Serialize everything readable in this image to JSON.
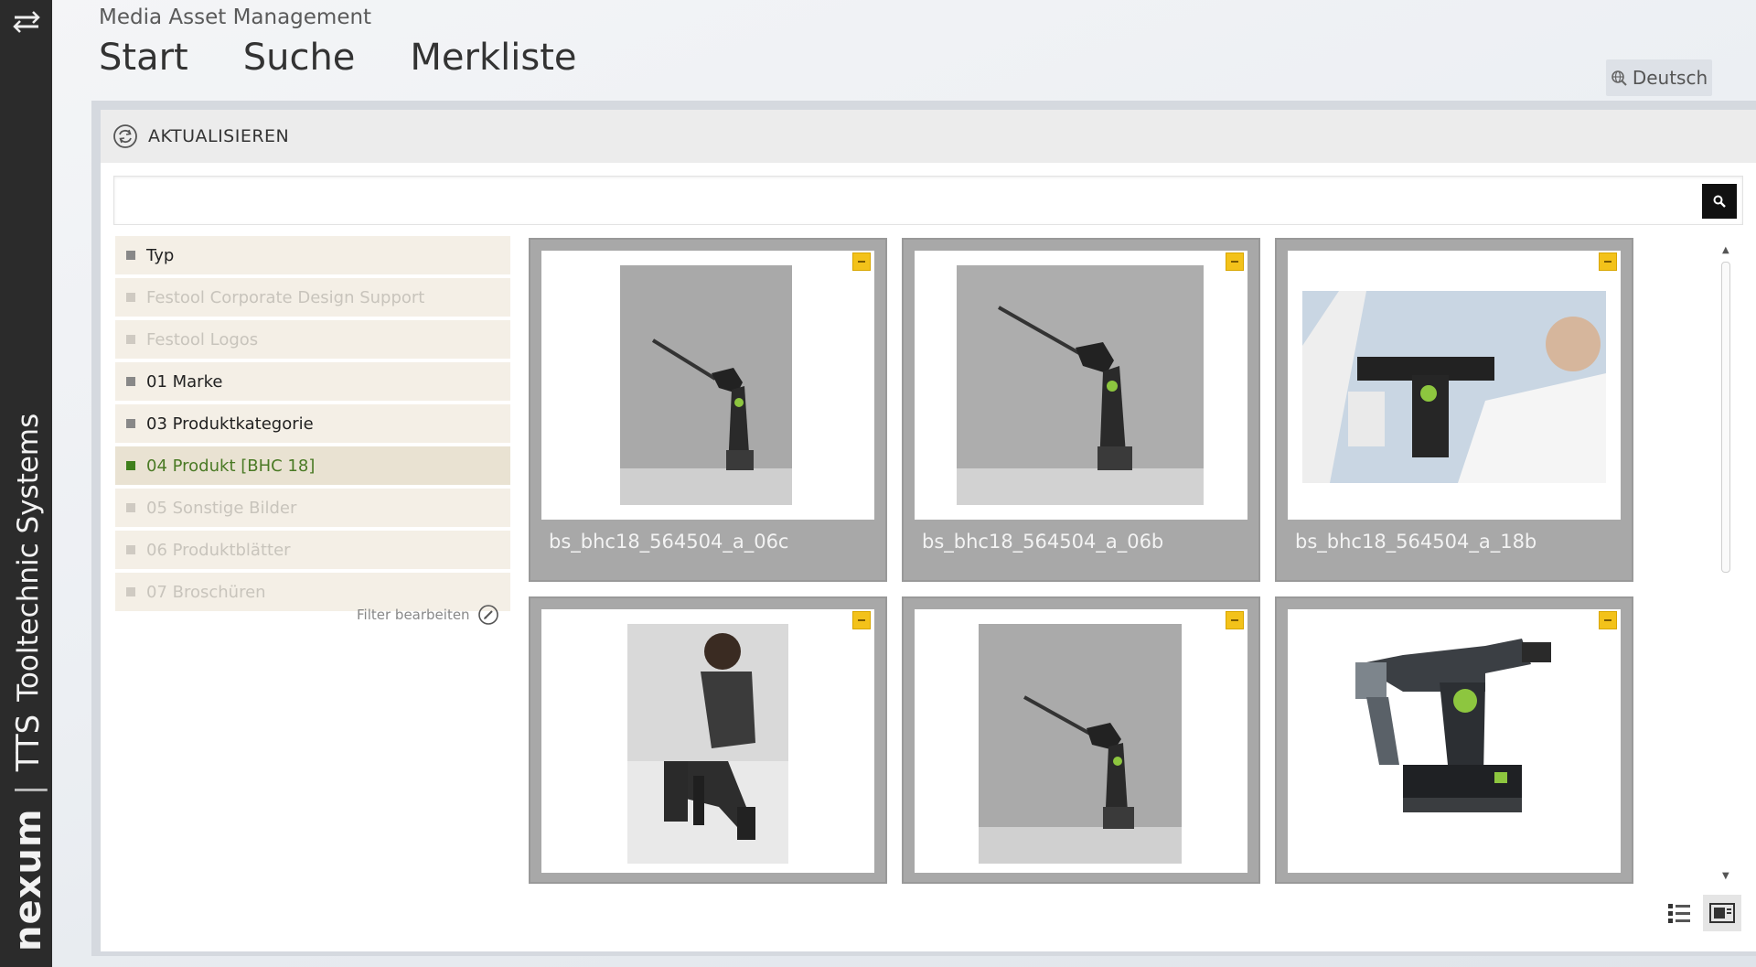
{
  "sidebar": {
    "brand": "nexum",
    "separator": "|",
    "tts": "TTS",
    "tagline": "Tooltechnic Systems",
    "menu_icon": "collapse-arrows-icon"
  },
  "header": {
    "app_title": "Media Asset Management",
    "nav": [
      "Start",
      "Suche",
      "Merkliste"
    ],
    "language": "Deutsch",
    "language_icon": "globe-icon"
  },
  "toolbar": {
    "refresh_label": "AKTUALISIEREN",
    "refresh_icon": "refresh-icon"
  },
  "search": {
    "value": "",
    "button_icon": "search-icon"
  },
  "filters": {
    "items": [
      {
        "label": "Typ",
        "state": "normal"
      },
      {
        "label": "Festool Corporate Design Support",
        "state": "dim"
      },
      {
        "label": "Festool Logos",
        "state": "dim"
      },
      {
        "label": "01 Marke",
        "state": "normal"
      },
      {
        "label": "03 Produktkategorie",
        "state": "normal"
      },
      {
        "label": "04 Produkt [BHC 18]",
        "state": "active"
      },
      {
        "label": "05 Sonstige Bilder",
        "state": "dim"
      },
      {
        "label": "06 Produktblätter",
        "state": "dim"
      },
      {
        "label": "07 Broschüren",
        "state": "dim"
      }
    ],
    "edit_label": "Filter bearbeiten",
    "edit_icon": "edit-icon",
    "active_color": "#3f7f1c"
  },
  "assets": [
    {
      "name": "bs_bhc18_564504_a_06c",
      "image": "drill-against-concrete-wall"
    },
    {
      "name": "bs_bhc18_564504_a_06b",
      "image": "drill-against-concrete-wall"
    },
    {
      "name": "bs_bhc18_564504_a_18b",
      "image": "worker-drilling-ceiling"
    },
    {
      "name": "",
      "image": "worker-kneeling-drilling-floor"
    },
    {
      "name": "",
      "image": "drill-against-concrete-wall"
    },
    {
      "name": "",
      "image": "cordless-hammer-drill-product"
    }
  ],
  "view_toggle": {
    "list_icon": "list-view-icon",
    "tile_icon": "tile-view-icon"
  }
}
